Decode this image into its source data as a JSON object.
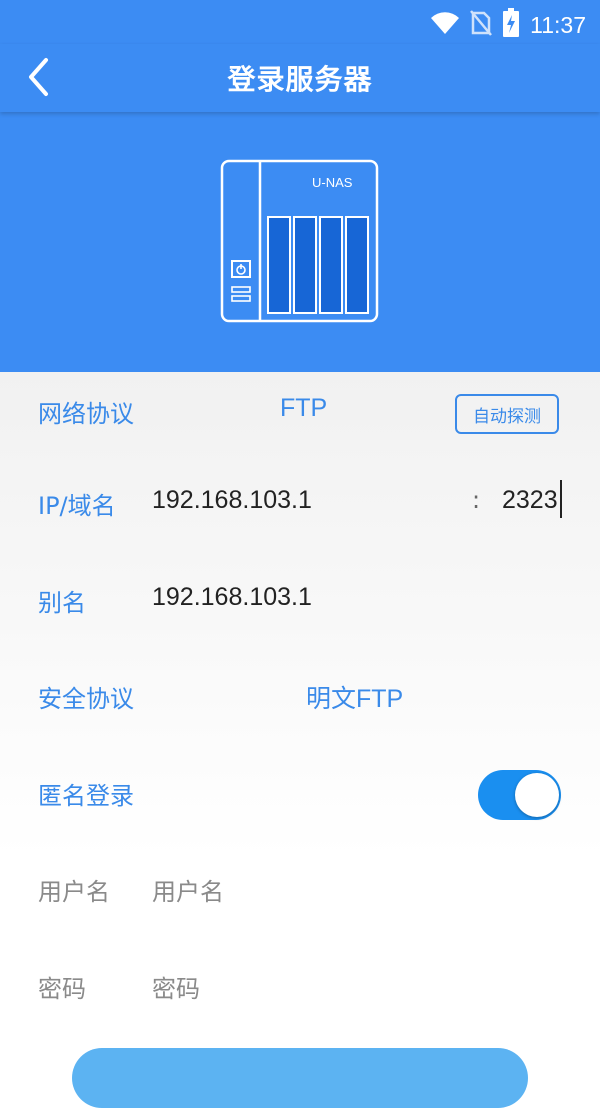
{
  "status_bar": {
    "time": "11:37",
    "icons": [
      "wifi-icon",
      "no-sim-icon",
      "battery-charging-icon"
    ]
  },
  "app_bar": {
    "title": "登录服务器",
    "back_icon": "chevron-left-icon"
  },
  "hero": {
    "device_label": "U-NAS"
  },
  "form": {
    "protocol": {
      "label": "网络协议",
      "value": "FTP",
      "detect_button": "自动探测"
    },
    "host": {
      "label": "IP/域名",
      "value": "192.168.103.1",
      "separator": ":",
      "port": "2323"
    },
    "alias": {
      "label": "别名",
      "value": "192.168.103.1"
    },
    "security": {
      "label": "安全协议",
      "value": "明文FTP"
    },
    "anonymous": {
      "label": "匿名登录",
      "enabled": true
    },
    "username": {
      "label": "用户名",
      "placeholder": "用户名"
    },
    "password": {
      "label": "密码",
      "placeholder": "密码"
    }
  },
  "colors": {
    "primary": "#3c8cf3",
    "label": "#3a8ae9",
    "toggle": "#1a8ff0",
    "button": "#5cb3f2"
  }
}
